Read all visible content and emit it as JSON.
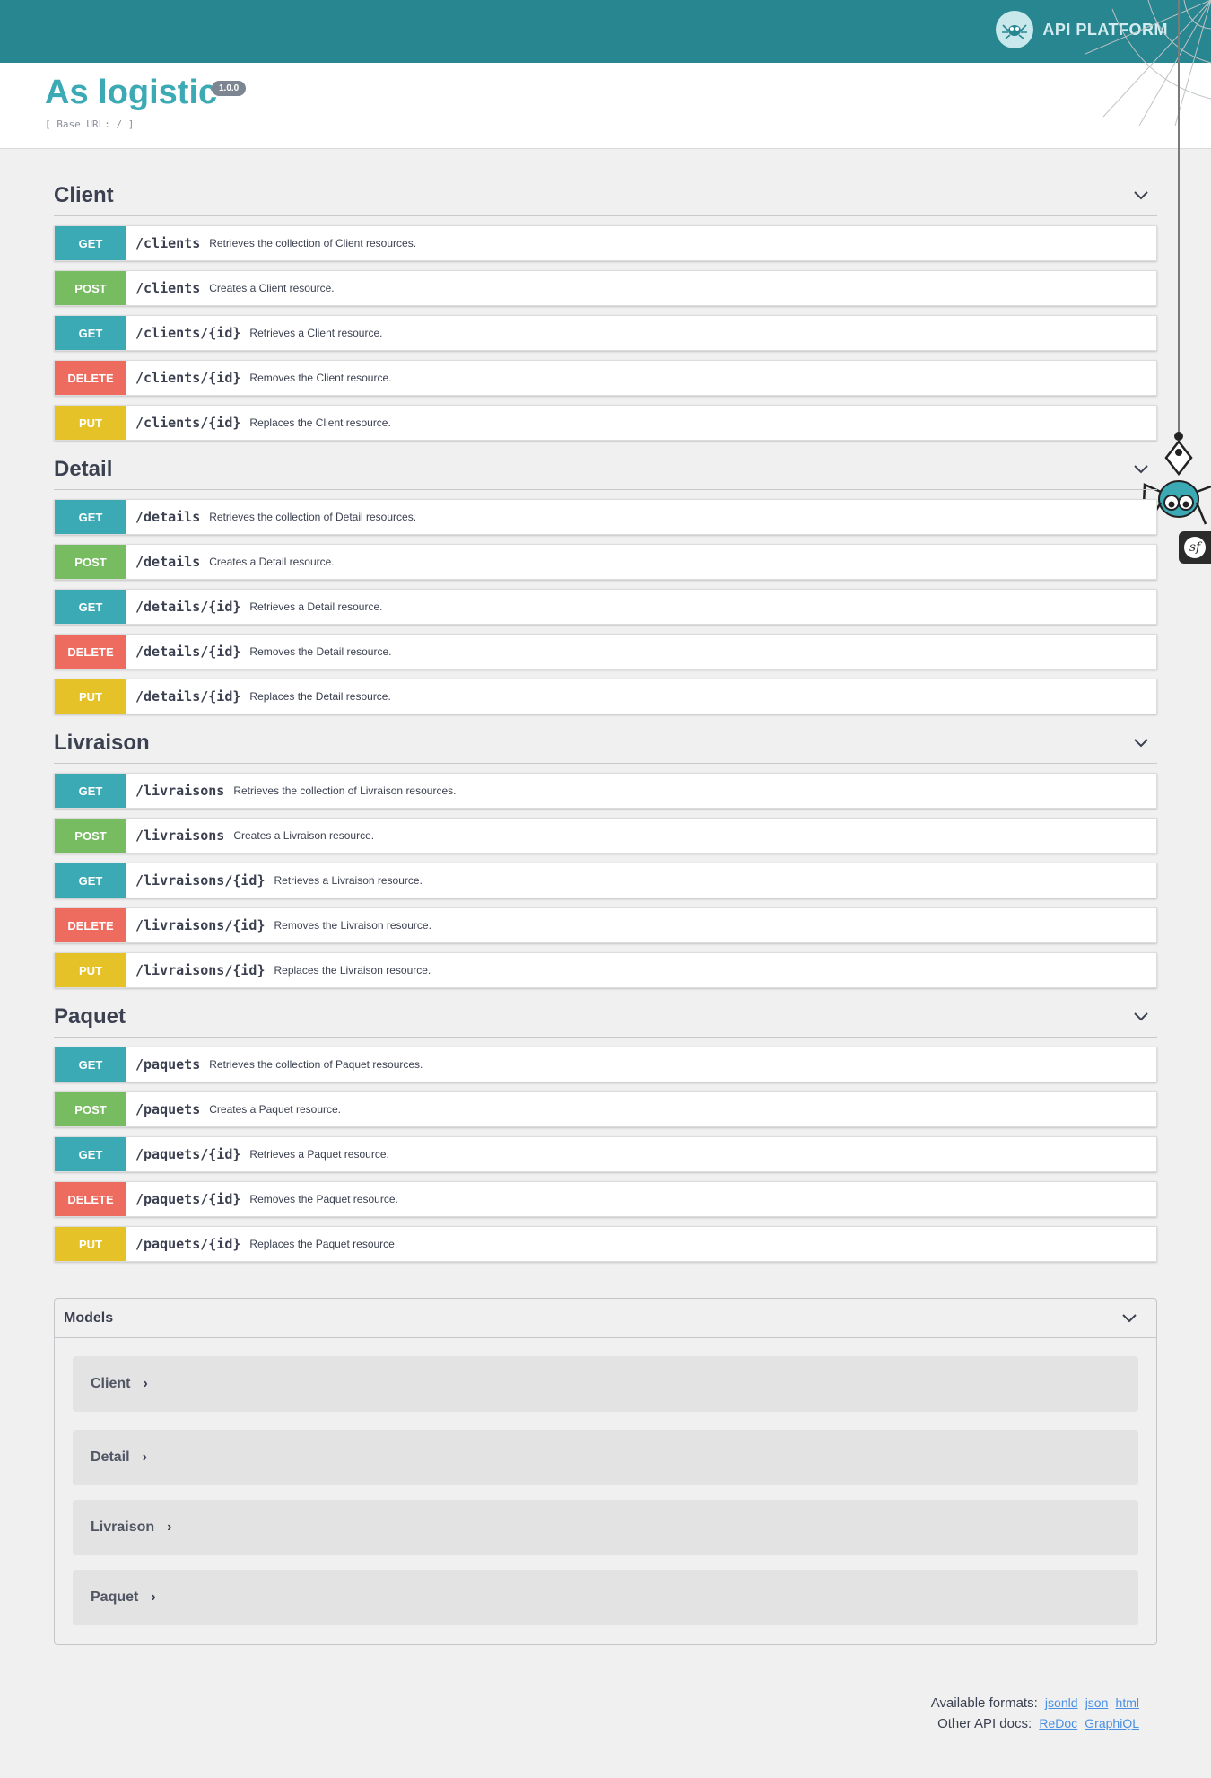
{
  "brand": {
    "name": "API PLATFORM",
    "logo_icon": "spider-logo-icon"
  },
  "info": {
    "title": "As logistic",
    "version": "1.0.0",
    "base_url": "[ Base URL: / ]"
  },
  "colors": {
    "get": "#3caab5",
    "post": "#78bc61",
    "delete": "#ed6b5f",
    "put": "#e6c229",
    "topbar": "#288690"
  },
  "sections": [
    {
      "title": "Client",
      "ops": [
        {
          "method": "GET",
          "path": "/clients",
          "summary": "Retrieves the collection of Client resources."
        },
        {
          "method": "POST",
          "path": "/clients",
          "summary": "Creates a Client resource."
        },
        {
          "method": "GET",
          "path": "/clients/{id}",
          "summary": "Retrieves a Client resource."
        },
        {
          "method": "DELETE",
          "path": "/clients/{id}",
          "summary": "Removes the Client resource."
        },
        {
          "method": "PUT",
          "path": "/clients/{id}",
          "summary": "Replaces the Client resource."
        }
      ]
    },
    {
      "title": "Detail",
      "ops": [
        {
          "method": "GET",
          "path": "/details",
          "summary": "Retrieves the collection of Detail resources."
        },
        {
          "method": "POST",
          "path": "/details",
          "summary": "Creates a Detail resource."
        },
        {
          "method": "GET",
          "path": "/details/{id}",
          "summary": "Retrieves a Detail resource."
        },
        {
          "method": "DELETE",
          "path": "/details/{id}",
          "summary": "Removes the Detail resource."
        },
        {
          "method": "PUT",
          "path": "/details/{id}",
          "summary": "Replaces the Detail resource."
        }
      ]
    },
    {
      "title": "Livraison",
      "ops": [
        {
          "method": "GET",
          "path": "/livraisons",
          "summary": "Retrieves the collection of Livraison resources."
        },
        {
          "method": "POST",
          "path": "/livraisons",
          "summary": "Creates a Livraison resource."
        },
        {
          "method": "GET",
          "path": "/livraisons/{id}",
          "summary": "Retrieves a Livraison resource."
        },
        {
          "method": "DELETE",
          "path": "/livraisons/{id}",
          "summary": "Removes the Livraison resource."
        },
        {
          "method": "PUT",
          "path": "/livraisons/{id}",
          "summary": "Replaces the Livraison resource."
        }
      ]
    },
    {
      "title": "Paquet",
      "ops": [
        {
          "method": "GET",
          "path": "/paquets",
          "summary": "Retrieves the collection of Paquet resources."
        },
        {
          "method": "POST",
          "path": "/paquets",
          "summary": "Creates a Paquet resource."
        },
        {
          "method": "GET",
          "path": "/paquets/{id}",
          "summary": "Retrieves a Paquet resource."
        },
        {
          "method": "DELETE",
          "path": "/paquets/{id}",
          "summary": "Removes the Paquet resource."
        },
        {
          "method": "PUT",
          "path": "/paquets/{id}",
          "summary": "Replaces the Paquet resource."
        }
      ]
    }
  ],
  "models": {
    "title": "Models",
    "items": [
      "Client",
      "Detail",
      "Livraison",
      "Paquet"
    ]
  },
  "footer": {
    "formats_label": "Available formats:",
    "formats": [
      "jsonld",
      "json",
      "html"
    ],
    "docs_label": "Other API docs:",
    "docs": [
      "ReDoc",
      "GraphiQL"
    ]
  },
  "sf_badge": "sf"
}
